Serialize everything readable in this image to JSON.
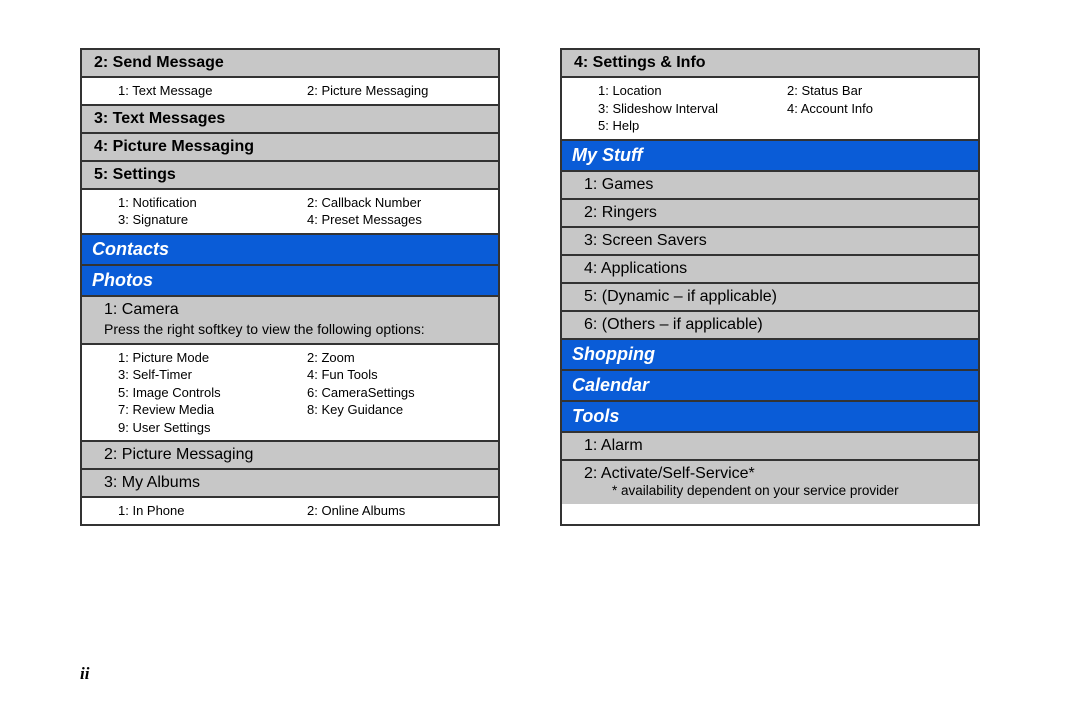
{
  "left": {
    "sendMessage": {
      "title": "2: Send Message",
      "subs": [
        "1: Text Message",
        "2: Picture Messaging"
      ]
    },
    "textMessages": "3: Text Messages",
    "pictureMessaging": "4: Picture Messaging",
    "settings": {
      "title": "5: Settings",
      "subs": [
        "1: Notification",
        "2: Callback Number",
        "3: Signature",
        "4: Preset Messages"
      ]
    },
    "contacts": "Contacts",
    "photos": "Photos",
    "camera": {
      "title": "1: Camera",
      "note": "Press the right softkey to view the following options:",
      "subs": [
        "1: Picture Mode",
        "2: Zoom",
        "3: Self-Timer",
        "4: Fun Tools",
        "5: Image Controls",
        "6: CameraSettings",
        "7: Review Media",
        "8: Key Guidance",
        "9: User Settings"
      ]
    },
    "pictureMessaging2": "2: Picture Messaging",
    "myAlbums": {
      "title": "3: My Albums",
      "subs": [
        "1: In Phone",
        "2: Online Albums"
      ]
    }
  },
  "right": {
    "settingsInfo": {
      "title": "4: Settings & Info",
      "subs": [
        "1: Location",
        "2: Status Bar",
        "3: Slideshow Interval",
        "4: Account Info",
        "5: Help"
      ]
    },
    "myStuff": "My Stuff",
    "games": "1: Games",
    "ringers": "2: Ringers",
    "screenSavers": "3: Screen Savers",
    "applications": "4: Applications",
    "dynamic": "5: (Dynamic – if applicable)",
    "others": "6: (Others – if applicable)",
    "shopping": "Shopping",
    "calendar": "Calendar",
    "tools": "Tools",
    "alarm": "1: Alarm",
    "activate": "2: Activate/Self-Service*",
    "footnote": "* availability dependent on your service provider"
  },
  "pageNumber": "ii"
}
